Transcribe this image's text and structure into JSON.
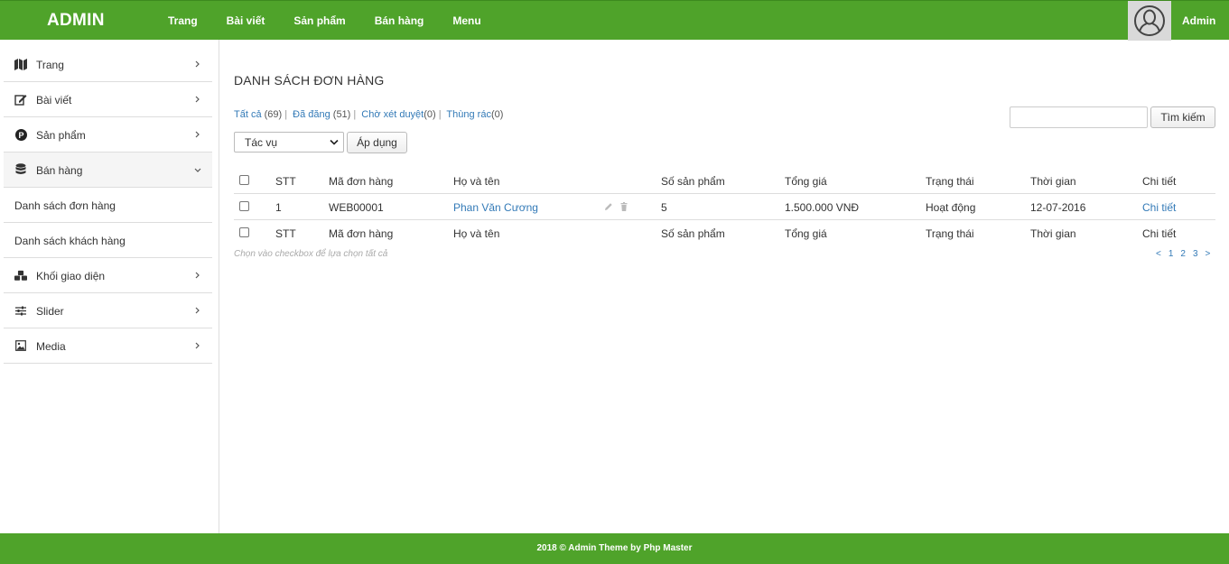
{
  "header": {
    "brand": "ADMIN",
    "nav": [
      "Trang",
      "Bài viết",
      "Sản phẩm",
      "Bán hàng",
      "Menu"
    ],
    "user": "Admin"
  },
  "sidebar": {
    "items": [
      {
        "label": "Trang",
        "icon": "map-icon"
      },
      {
        "label": "Bài viết",
        "icon": "edit-icon"
      },
      {
        "label": "Sản phẩm",
        "icon": "product-icon"
      },
      {
        "label": "Bán hàng",
        "icon": "database-icon"
      },
      {
        "label": "Danh sách đơn hàng"
      },
      {
        "label": "Danh sách khách hàng"
      },
      {
        "label": "Khối giao diện",
        "icon": "cubes-icon"
      },
      {
        "label": "Slider",
        "icon": "sliders-icon"
      },
      {
        "label": "Media",
        "icon": "image-icon"
      }
    ]
  },
  "main": {
    "title": "DANH SÁCH ĐƠN HÀNG",
    "filters": {
      "all_label": "Tất cả",
      "all_count": "(69)",
      "published_label": "Đã đăng",
      "published_count": "(51)",
      "pending_label": "Chờ xét duyệt",
      "pending_count": "(0)",
      "trash_label": "Thùng rác",
      "trash_count": "(0)"
    },
    "search_button": "Tìm kiếm",
    "bulk_select": "Tác vụ",
    "apply_button": "Áp dụng",
    "columns": [
      "STT",
      "Mã đơn hàng",
      "Họ và tên",
      "Số sản phẩm",
      "Tổng giá",
      "Trạng thái",
      "Thời gian",
      "Chi tiết"
    ],
    "rows": [
      {
        "stt": "1",
        "code": "WEB00001",
        "name": "Phan Văn Cương",
        "qty": "5",
        "total": "1.500.000 VNĐ",
        "status": "Hoạt động",
        "date": "12-07-2016",
        "detail": "Chi tiết"
      }
    ],
    "hint": "Chọn vào checkbox để lựa chọn tất cả",
    "pagination": [
      "<",
      "1",
      "2",
      "3",
      ">"
    ]
  },
  "footer": {
    "text": "2018 © Admin Theme by Php Master"
  }
}
